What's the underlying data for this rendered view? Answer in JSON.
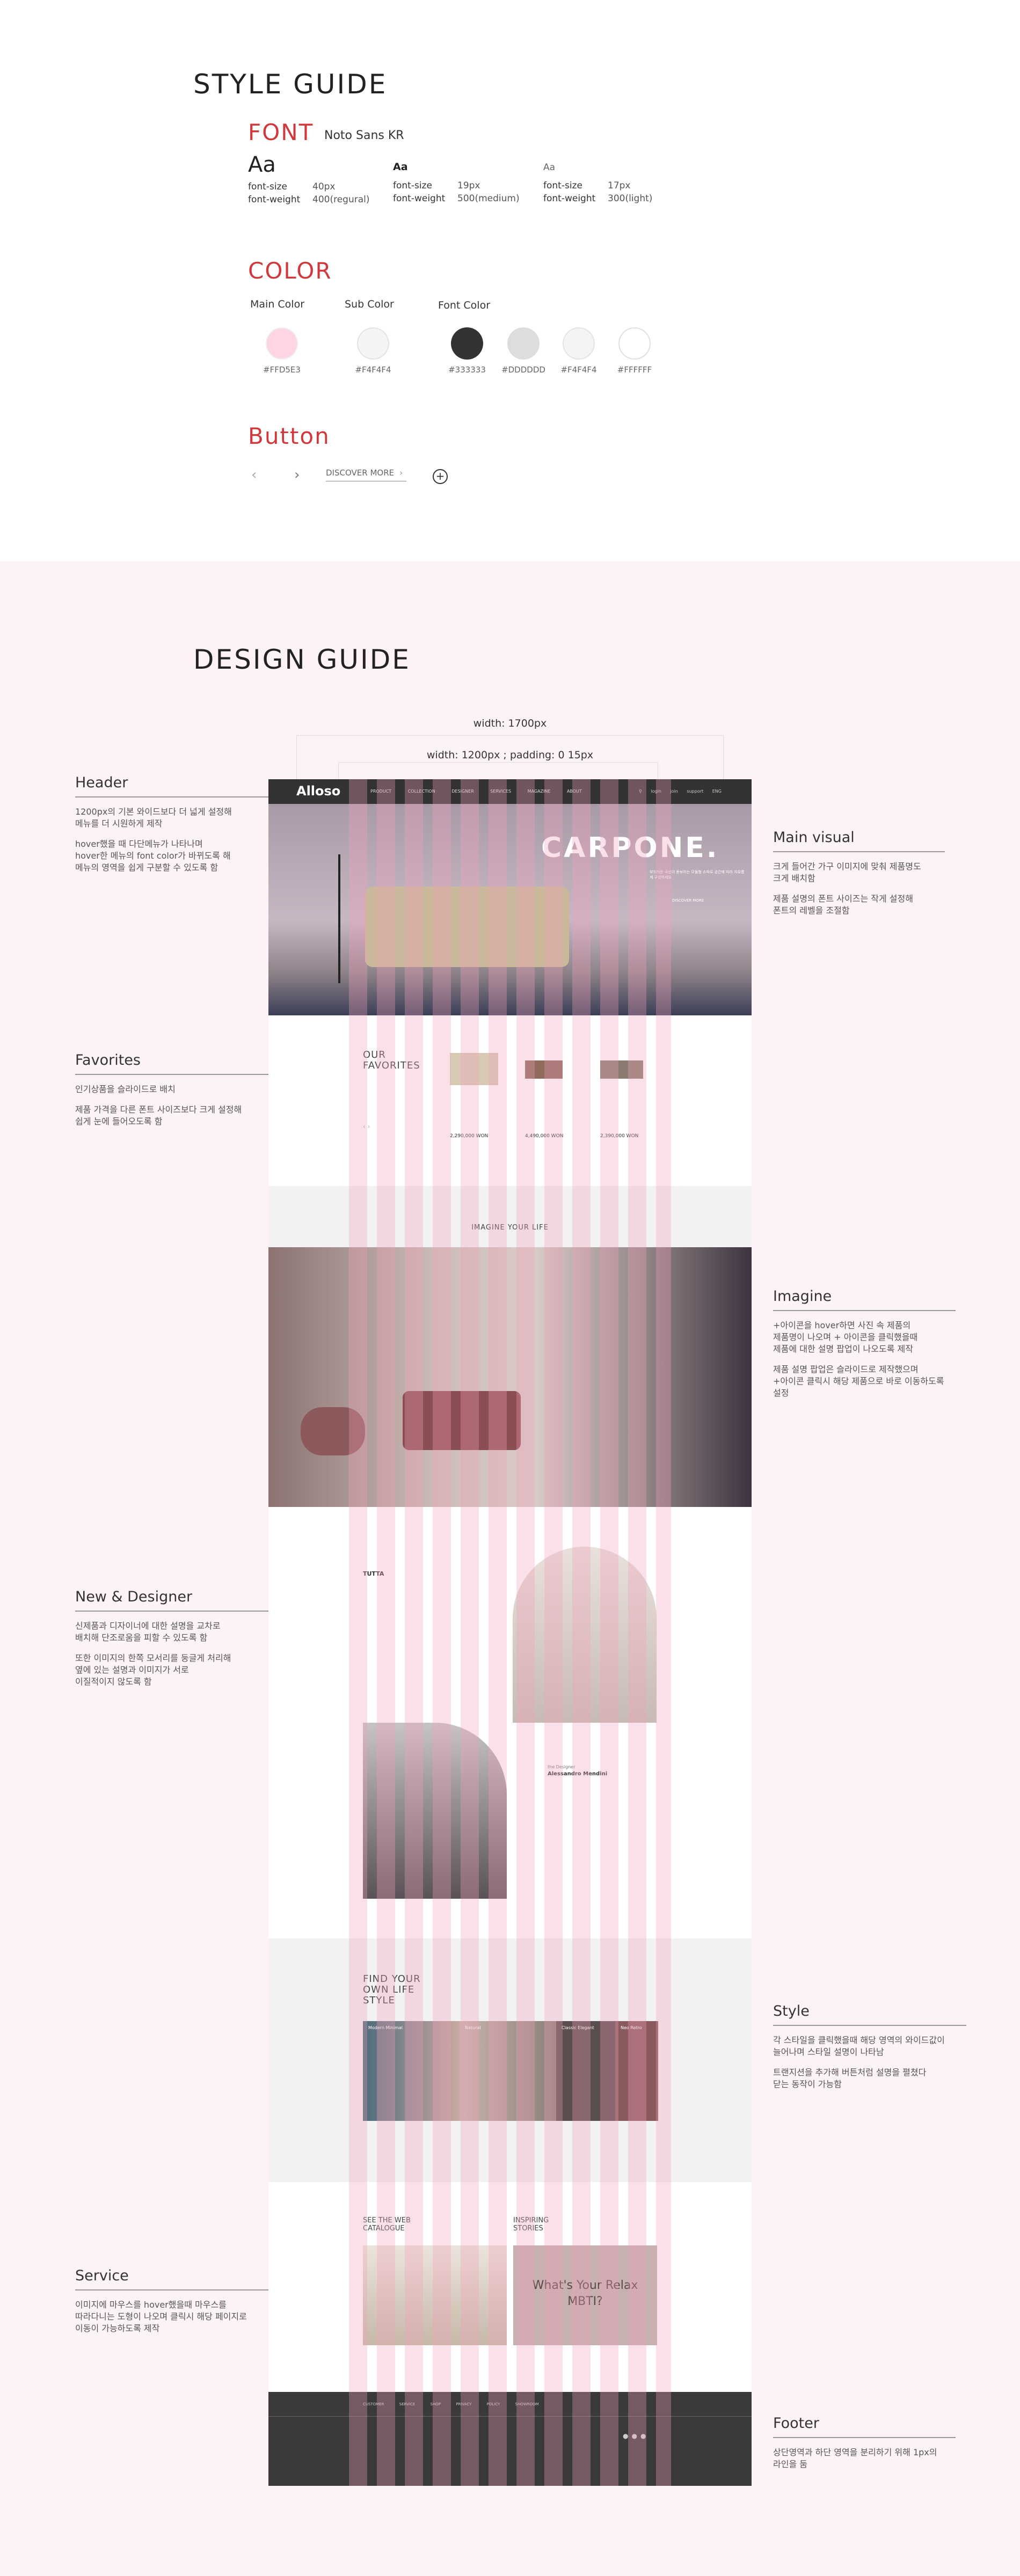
{
  "style_guide": {
    "title": "STYLE GUIDE",
    "font": {
      "heading": "FONT",
      "family": "Noto Sans KR",
      "samples": [
        {
          "aa": "Aa",
          "size_label": "font-size",
          "size": "40px",
          "weight_label": "font-weight",
          "weight": "400(regural)"
        },
        {
          "aa": "Aa",
          "size_label": "font-size",
          "size": "19px",
          "weight_label": "font-weight",
          "weight": "500(medium)"
        },
        {
          "aa": "Aa",
          "size_label": "font-size",
          "size": "17px",
          "weight_label": "font-weight",
          "weight": "300(light)"
        }
      ]
    },
    "color": {
      "heading": "COLOR",
      "main_label": "Main Color",
      "sub_label": "Sub Color",
      "font_label": "Font Color",
      "main": "#FFD5E3",
      "sub": "#F4F4F4",
      "fonts": [
        "#333333",
        "#DDDDDD",
        "#F4F4F4",
        "#FFFFFF"
      ]
    },
    "button": {
      "heading": "Button",
      "discover": "DISCOVER MORE"
    }
  },
  "design_guide": {
    "title": "DESIGN GUIDE",
    "width_outer": "width: 1700px",
    "width_inner": "width: 1200px ; padding: 0 15px",
    "annotations": {
      "header": {
        "title": "Header",
        "lines": [
          "1200px의 기본 와이드보다 더 넓게 설정해",
          "메뉴를 더 시원하게 제작",
          "hover했을 때 다단메뉴가 나타나며",
          "hover한 메뉴의 font color가 바뀌도록 해",
          "메뉴의 영역을 쉽게 구분할 수 있도록 함"
        ]
      },
      "favorites": {
        "title": "Favorites",
        "lines": [
          "인기상품을 슬라이드로 배치",
          "제품 가격을 다른 폰트 사이즈보다 크게 설정해",
          "쉽게 눈에 들어오도록 함"
        ]
      },
      "new_designer": {
        "title": "New & Designer",
        "lines": [
          "신제품과 디자이너에 대한 설명을 교차로",
          "배치해 단조로움을 피할 수 있도록 함",
          "또한 이미지의 한쪽 모서리를 둥글게 처리해",
          "옆에 있는 설명과 이미지가 서로",
          "이질적이지 않도록 함"
        ]
      },
      "service": {
        "title": "Service",
        "lines": [
          "이미지에 마우스를 hover했을때 마우스를",
          "따라다니는 도형이 나오며 클릭시 해당 페이지로",
          "이동이 가능하도록 제작"
        ]
      },
      "main_visual": {
        "title": "Main visual",
        "lines": [
          "크게 들어간 가구 이미지에 맞춰 제품명도",
          "크게 배치함",
          "제품 설명의 폰트 사이즈는 작게 설정해",
          "폰트의 레벨을 조절함"
        ]
      },
      "imagine": {
        "title": "Imagine",
        "lines": [
          "+아이콘을 hover하면 사진 속 제품의",
          "제품명이 나오며 + 아이콘을 클릭했을때",
          "제품에 대한 설명 팝업이 나오도록 제작",
          "제품 설명 팝업은 슬라이드로 제작했으며",
          "+아이콘 클릭시 해당 제품으로 바로 이동하도록",
          "설정"
        ]
      },
      "style": {
        "title": "Style",
        "lines": [
          "각 스타일을 클릭했을때 해당 영역의 와이드값이",
          "늘어나며 스타일 설명이 나타남",
          "트랜지션을 추가해 버튼처럼 설명을 펼쳤다",
          "닫는 동작이 가능함"
        ]
      },
      "footer": {
        "title": "Footer",
        "lines": [
          "상단영역과 하단 영역을 분리하기 위해 1px의",
          "라인을 둠"
        ]
      }
    },
    "mock": {
      "logo": "Alloso",
      "nav": [
        "PRODUCT",
        "COLLECTION",
        "DESIGNER",
        "SERVICES",
        "MAGAZINE",
        "ABOUT"
      ],
      "util": [
        "login",
        "join",
        "support",
        "ENG"
      ],
      "hero_title": "CARPONE.",
      "hero_desc": "부드러운 곡선이 돋보이는 모듈형 소파로 공간에 따라 자유롭게 구성하세요",
      "hero_btn": "DISCOVER MORE",
      "fav_title": "OUR FAVORITES",
      "fav_prices": [
        "2,290,000 WON",
        "4,490,000 WON",
        "2,390,000 WON"
      ],
      "imagine_title": "IMAGINE YOUR LIFE",
      "new_name": "TUTTA",
      "designer_label": "the Designer",
      "designer_name": "Alessandro Mendini",
      "style_title": "FIND YOUR OWN LIFE STYLE",
      "style_items": [
        "Modern Minimal",
        "Natural",
        "Classic Elegant",
        "Neo Retro"
      ],
      "catalogue_title": "SEE THE WEB CATALOGUE",
      "stories_title": "INSPIRING STORIES",
      "mbti": "What's Your Relax MBTI?",
      "footer_nav": [
        "CUSTOMER SERVICE",
        "SHOP",
        "PRIVACY POLICY",
        "SHOWROOM"
      ]
    }
  }
}
